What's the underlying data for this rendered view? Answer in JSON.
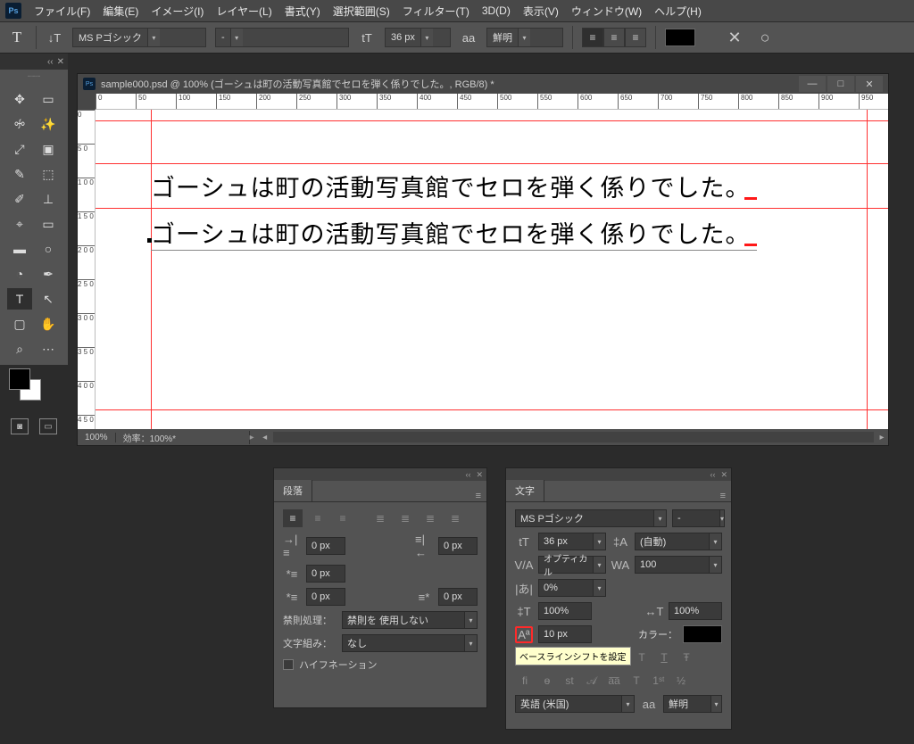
{
  "menu": {
    "items": [
      "ファイル(F)",
      "編集(E)",
      "イメージ(I)",
      "レイヤー(L)",
      "書式(Y)",
      "選択範囲(S)",
      "フィルター(T)",
      "3D(D)",
      "表示(V)",
      "ウィンドウ(W)",
      "ヘルプ(H)"
    ]
  },
  "optbar": {
    "tool_glyph": "T",
    "orient_glyph": "↓T",
    "font": "MS Pゴシック",
    "style": "-",
    "size_icon": "tT",
    "size": "36 px",
    "aa_label": "aa",
    "aa_mode": "鮮明"
  },
  "tools": [
    "✥",
    "▭",
    "ꖢ",
    "✎",
    "⤢",
    "▣",
    "✂",
    "⬚",
    "✎",
    "▣",
    "✐",
    "⊥",
    "⌖",
    "▭",
    "◔",
    "⬚",
    "T",
    "↖",
    "▢",
    "✋",
    "⌕",
    "⋯"
  ],
  "swatch_small": [
    "◧",
    "◫",
    "▭"
  ],
  "doc": {
    "title": "sample000.psd @ 100% (ゴーシュは町の活動写真館でセロを弾く係りでした。, RGB/8) *",
    "zoom": "100%",
    "efficiency": "効率：100%*",
    "ruler_h": [
      "0",
      "50",
      "100",
      "150",
      "200",
      "250",
      "300",
      "350",
      "400",
      "450",
      "500",
      "550",
      "600",
      "650",
      "700",
      "750",
      "800",
      "850",
      "900",
      "950"
    ],
    "ruler_v": [
      "0",
      "50",
      "100",
      "150",
      "200",
      "250",
      "300",
      "350",
      "400",
      "450"
    ],
    "text1": "ゴーシュは町の活動写真館でセロを弾く係りでした。",
    "text2": "ゴーシュは町の活動写真館でセロを弾く係りでした。"
  },
  "paragraph": {
    "title": "段落",
    "indent_left": "0 px",
    "indent_right": "0 px",
    "indent_first": "0 px",
    "space_before": "0 px",
    "space_after": "0 px",
    "kinsoku_label": "禁則処理：",
    "kinsoku_value": "禁則を 使用しない",
    "mojikumi_label": "文字組み：",
    "mojikumi_value": "なし",
    "hyphen": "ハイフネーション"
  },
  "character": {
    "title": "文字",
    "font": "MS Pゴシック",
    "style": "-",
    "size": "36 px",
    "leading": "(自動)",
    "kerning": "オプティカル",
    "tracking": "100",
    "tsume": "0%",
    "vscale": "100%",
    "hscale": "100%",
    "baseline": "10 px",
    "color_label": "カラー：",
    "tooltip": "ベースラインシフトを設定",
    "lang": "英語 (米国)",
    "aa_label": "aa",
    "aa": "鮮明"
  }
}
